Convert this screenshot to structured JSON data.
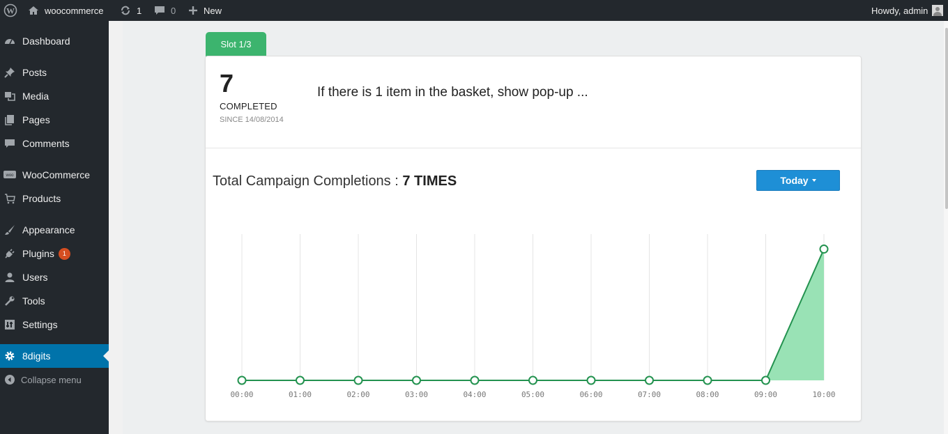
{
  "adminbar": {
    "site_name": "woocommerce",
    "updates_count": "1",
    "comments_count": "0",
    "new_label": "New",
    "greeting": "Howdy, admin",
    "icons": [
      "wordpress-icon",
      "home-icon",
      "updates-icon",
      "comment-icon",
      "plus-icon",
      "avatar"
    ]
  },
  "sidebar": {
    "items": [
      {
        "label": "Dashboard",
        "icon": "dashboard-icon"
      },
      {
        "label": "Posts",
        "icon": "pin-icon"
      },
      {
        "label": "Media",
        "icon": "media-icon"
      },
      {
        "label": "Pages",
        "icon": "pages-icon"
      },
      {
        "label": "Comments",
        "icon": "comment-icon"
      },
      {
        "label": "WooCommerce",
        "icon": "woocommerce-icon"
      },
      {
        "label": "Products",
        "icon": "cart-icon"
      },
      {
        "label": "Appearance",
        "icon": "brush-icon"
      },
      {
        "label": "Plugins",
        "icon": "plugin-icon",
        "badge": "1"
      },
      {
        "label": "Users",
        "icon": "user-icon"
      },
      {
        "label": "Tools",
        "icon": "wrench-icon"
      },
      {
        "label": "Settings",
        "icon": "settings-icon"
      },
      {
        "label": "8digits",
        "icon": "gear-icon",
        "active": true
      }
    ],
    "collapse_label": "Collapse menu"
  },
  "slot": {
    "label": "Slot 1/3"
  },
  "campaign": {
    "count": "7",
    "completed_label": "COMPLETED",
    "since": "SINCE 14/08/2014",
    "description": "If there is 1 item in the basket, show pop-up ..."
  },
  "totals": {
    "label": "Total Campaign Completions : ",
    "value": "7 TIMES"
  },
  "filter": {
    "label": "Today"
  },
  "colors": {
    "accent": "#0073aa",
    "slot_tab": "#3cb46e",
    "line": "#23924f",
    "fill": "#99e2b5",
    "button": "#1e8fd6",
    "badge": "#d54e21"
  },
  "chart_data": {
    "type": "area",
    "x": [
      "00:00",
      "01:00",
      "02:00",
      "03:00",
      "04:00",
      "05:00",
      "06:00",
      "07:00",
      "08:00",
      "09:00",
      "10:00"
    ],
    "values": [
      0,
      0,
      0,
      0,
      0,
      0,
      0,
      0,
      0,
      0,
      7
    ],
    "title": "",
    "xlabel": "",
    "ylabel": "",
    "ylim": [
      0,
      7.8
    ],
    "grid": "vertical"
  }
}
